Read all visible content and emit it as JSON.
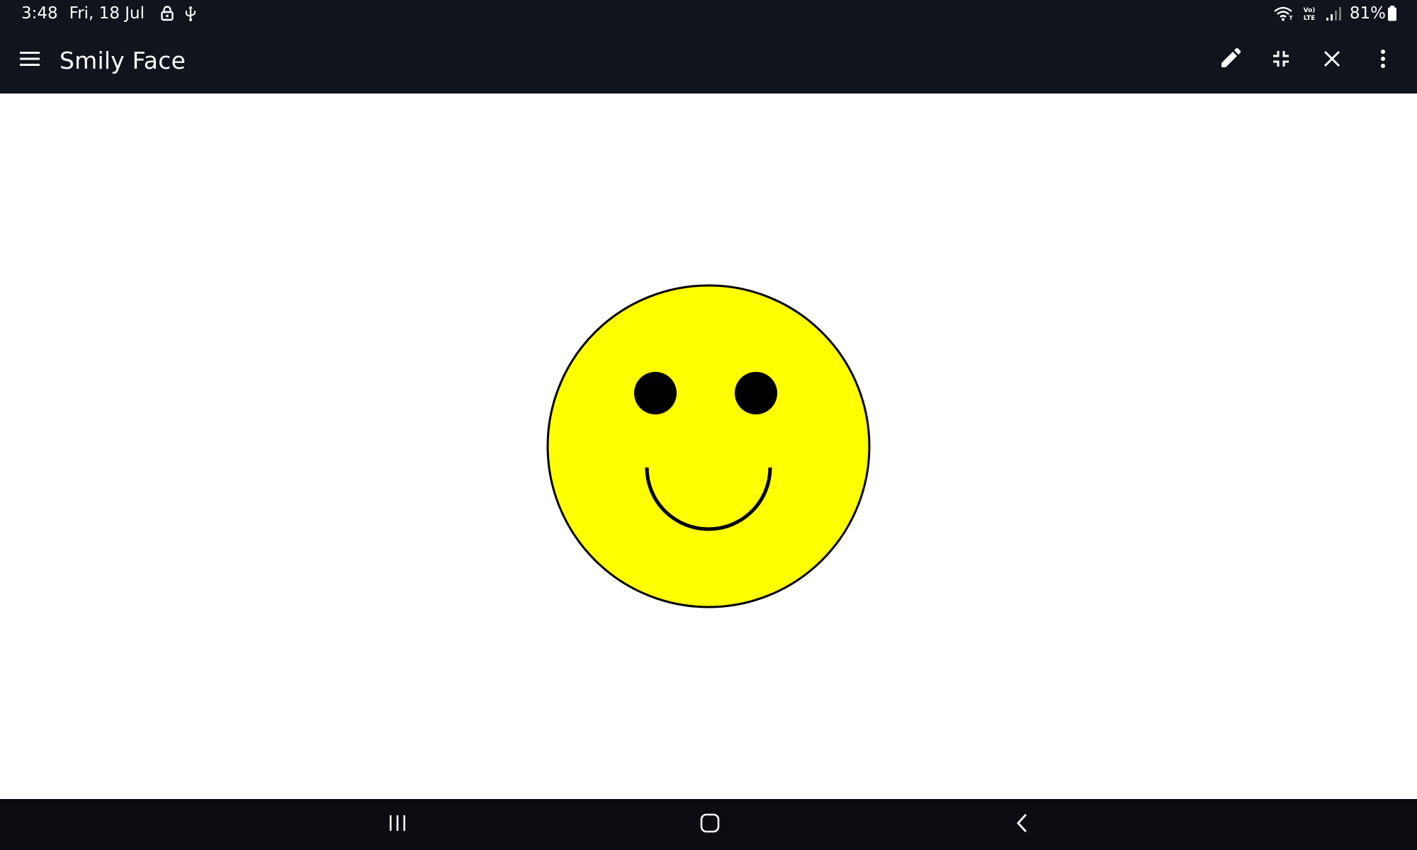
{
  "status_bar": {
    "time": "3:48",
    "date": "Fri, 18 Jul",
    "battery_percent": "81%",
    "icons": [
      "lock-icon",
      "usb-icon",
      "wifi-icon",
      "volte-icon",
      "signal-icon",
      "battery-icon"
    ]
  },
  "app_bar": {
    "title": "Smily Face",
    "icons": [
      "menu-icon",
      "pencil-icon",
      "exit-fullscreen-icon",
      "close-icon",
      "more-vert-icon"
    ]
  },
  "drawing": {
    "face_color": "#ffff00",
    "outline_color": "#000000",
    "eye_color": "#000000"
  },
  "nav_bar": {
    "icons": [
      "recents-icon",
      "home-icon",
      "back-icon"
    ]
  },
  "colors": {
    "bar_background": "#11141c",
    "nav_background": "#0b0d12",
    "foreground": "#ffffff"
  }
}
